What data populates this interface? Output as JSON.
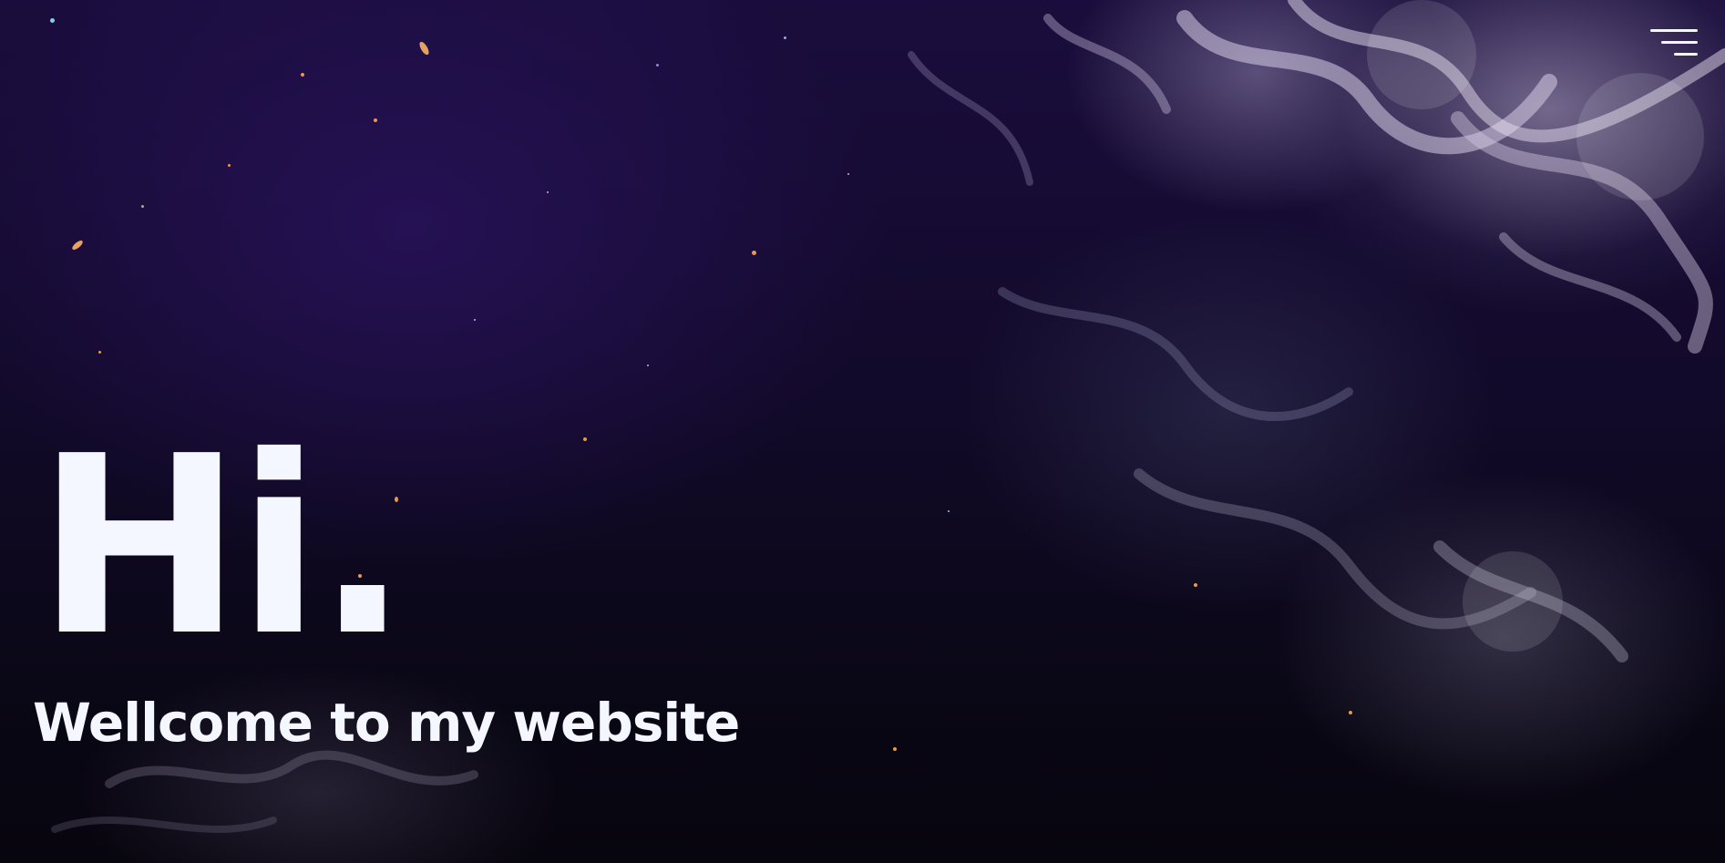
{
  "hero": {
    "title": "Hi.",
    "subtitle": "Wellcome to my website"
  },
  "menu": {
    "icon": "hamburger-menu-icon"
  },
  "colors": {
    "text": "#f4f7ff",
    "background_top": "#1a0d3d",
    "background_bottom": "#07050e",
    "accent_speck": "#e89a4a"
  }
}
